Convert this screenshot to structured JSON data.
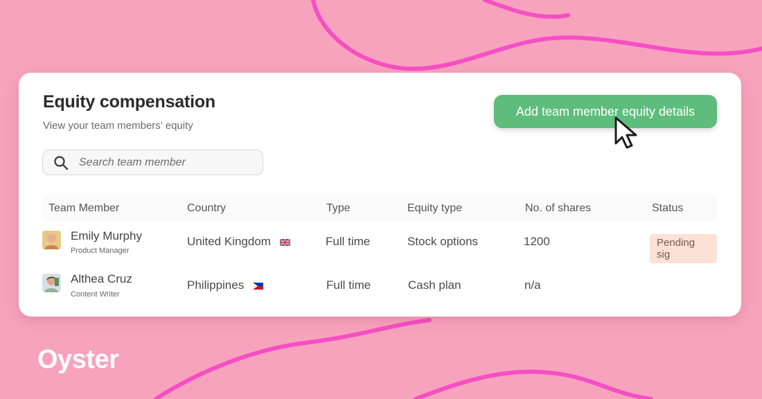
{
  "card": {
    "title": "Equity compensation",
    "subtitle": "View your team members’ equity",
    "add_button_label": "Add team member equity details"
  },
  "search": {
    "placeholder": "Search team member",
    "icon": "search-icon"
  },
  "table": {
    "headers": [
      "Team Member",
      "Country",
      "Type",
      "Equity type",
      "No. of shares",
      "Status"
    ],
    "rows": [
      {
        "name": "Emily Murphy",
        "role": "Product Manager",
        "country": "United Kingdom",
        "flag": "uk-flag-icon",
        "type": "Full time",
        "equity_type": "Stock options",
        "shares": "1200",
        "status": "Pending sig"
      },
      {
        "name": "Althea Cruz",
        "role": "Content Writer",
        "country": "Philippines",
        "flag": "philippines-flag-icon",
        "type": "Full time",
        "equity_type": "Cash plan",
        "shares": "n/a",
        "status": ""
      }
    ]
  },
  "brand": {
    "logo_text": "Oyster"
  },
  "colors": {
    "background": "#f7a3bd",
    "squiggle": "#f54fc4",
    "button": "#5ebd7c",
    "status_badge": "#fbe1d6"
  }
}
